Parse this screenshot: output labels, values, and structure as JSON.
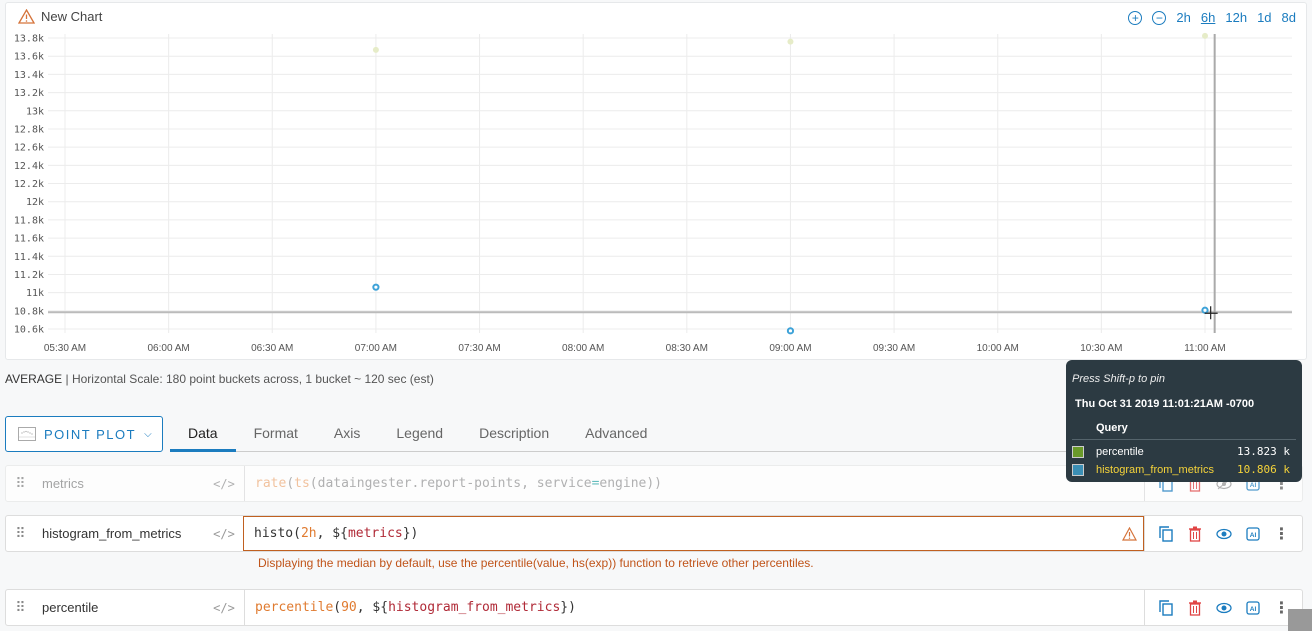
{
  "chart": {
    "title": "New Chart",
    "range_buttons": [
      {
        "label": "2h",
        "active": false
      },
      {
        "label": "6h",
        "active": true
      },
      {
        "label": "12h",
        "active": false
      },
      {
        "label": "1d",
        "active": false
      },
      {
        "label": "8d",
        "active": false
      }
    ],
    "zoom_in_icon": "zoom-in-icon",
    "zoom_out_icon": "zoom-out-icon"
  },
  "chart_data": {
    "type": "scatter",
    "title": "New Chart",
    "xlabel": "",
    "ylabel": "",
    "x_ticks": [
      "05:30 AM",
      "06:00 AM",
      "06:30 AM",
      "07:00 AM",
      "07:30 AM",
      "08:00 AM",
      "08:30 AM",
      "09:00 AM",
      "09:30 AM",
      "10:00 AM",
      "10:30 AM",
      "11:00 AM"
    ],
    "x_range_minutes": [
      330,
      712
    ],
    "y_ticks": [
      "10.6k",
      "10.8k",
      "11k",
      "11.2k",
      "11.4k",
      "11.6k",
      "11.8k",
      "12k",
      "12.2k",
      "12.4k",
      "12.6k",
      "12.8k",
      "13k",
      "13.2k",
      "13.4k",
      "13.6k",
      "13.8k"
    ],
    "y_tick_values": [
      10600,
      10800,
      11000,
      11200,
      11400,
      11600,
      11800,
      12000,
      12200,
      12400,
      12600,
      12800,
      13000,
      13200,
      13400,
      13600,
      13800
    ],
    "ylim": [
      10600,
      13800
    ],
    "grid": true,
    "series": [
      {
        "name": "percentile",
        "color": "#e6ecc8",
        "x": [
          "07:00",
          "09:00",
          "11:00"
        ],
        "x_minutes": [
          420,
          540,
          660
        ],
        "values": [
          13670,
          13760,
          13823
        ]
      },
      {
        "name": "histogram_from_metrics",
        "color": "#3da2d8",
        "x": [
          "07:00",
          "09:00",
          "11:00"
        ],
        "x_minutes": [
          420,
          540,
          660
        ],
        "values": [
          11060,
          10580,
          10806
        ]
      }
    ],
    "crosshair": {
      "x_minutes": 661.35,
      "y_value": 10806
    }
  },
  "summary": {
    "aggregation": "AVERAGE",
    "separator": "|",
    "scale_text": "Horizontal Scale: 180 point buckets across, 1 bucket ~ 120 sec (est)"
  },
  "plot_type": {
    "label": "POINT PLOT"
  },
  "tabs": [
    {
      "label": "Data",
      "active": true
    },
    {
      "label": "Format",
      "active": false
    },
    {
      "label": "Axis",
      "active": false
    },
    {
      "label": "Legend",
      "active": false
    },
    {
      "label": "Description",
      "active": false
    },
    {
      "label": "Advanced",
      "active": false
    }
  ],
  "queries": [
    {
      "name": "metrics",
      "code_icon": "</>",
      "expr": [
        {
          "t": "rate",
          "c": "fn"
        },
        {
          "t": "(",
          "c": ""
        },
        {
          "t": "ts",
          "c": "fn"
        },
        {
          "t": "(dataingester.report-points, service",
          "c": ""
        },
        {
          "t": "=",
          "c": "op"
        },
        {
          "t": "engine))",
          "c": ""
        }
      ]
    },
    {
      "name": "histogram_from_metrics",
      "code_icon": "</>",
      "expr": [
        {
          "t": "histo(",
          "c": ""
        },
        {
          "t": "2h",
          "c": "num"
        },
        {
          "t": ", ${",
          "c": ""
        },
        {
          "t": "metrics",
          "c": "var"
        },
        {
          "t": "})",
          "c": ""
        }
      ]
    },
    {
      "name": "percentile",
      "code_icon": "</>",
      "expr": [
        {
          "t": "percentile",
          "c": "fn"
        },
        {
          "t": "(",
          "c": ""
        },
        {
          "t": "90",
          "c": "num"
        },
        {
          "t": ", ${",
          "c": ""
        },
        {
          "t": "histogram_from_metrics",
          "c": "var"
        },
        {
          "t": "})",
          "c": ""
        }
      ]
    }
  ],
  "hint": "Displaying the median by default, use the percentile(value, hs(exp)) function to retrieve other percentiles.",
  "tooltip": {
    "pin_hint": "Press Shift-p to pin",
    "timestamp": "Thu Oct 31 2019 11:01:21AM -0700",
    "header": "Query",
    "rows": [
      {
        "name": "percentile",
        "value": "13.823 k",
        "color": "#6a9a2a",
        "highlight": false
      },
      {
        "name": "histogram_from_metrics",
        "value": "10.806 k",
        "color": "#3b8fb5",
        "highlight": true
      }
    ]
  },
  "colors": {
    "accent": "#1b7cbf",
    "warning": "#c0541a",
    "delete": "#e04545"
  }
}
